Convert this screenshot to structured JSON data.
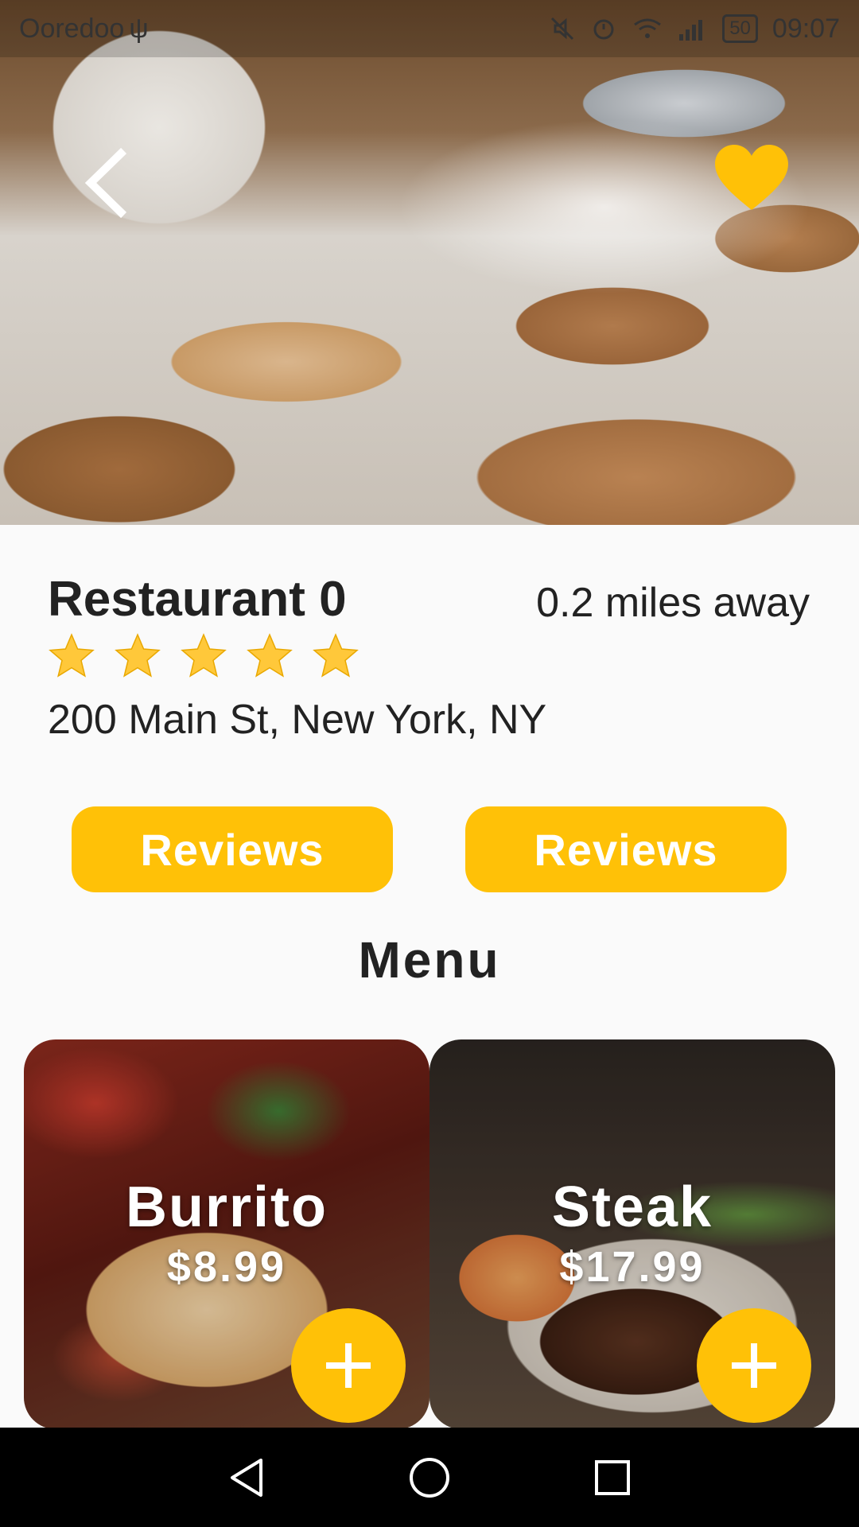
{
  "status_bar": {
    "carrier": "Ooredoo",
    "usb_symbol": "ψ",
    "battery": "50",
    "time": "09:07"
  },
  "icons": {
    "back": "chevron-left-icon",
    "favorite": "heart-icon",
    "rating": "star-icon",
    "add": "plus-icon",
    "nav_back": "triangle-back-icon",
    "nav_home": "circle-home-icon",
    "nav_recents": "square-recents-icon"
  },
  "colors": {
    "accent": "#ffc107",
    "text": "#222222",
    "background": "#fafafa",
    "navbar": "#000000"
  },
  "restaurant": {
    "name": "Restaurant 0",
    "distance": "0.2 miles away",
    "rating": 5,
    "rating_max": 5,
    "address": "200 Main St, New York, NY"
  },
  "actions": {
    "left_label": "Reviews",
    "right_label": "Reviews"
  },
  "menu": {
    "title": "Menu",
    "items": [
      {
        "name": "Burrito",
        "price": "$8.99"
      },
      {
        "name": "Steak",
        "price": "$17.99"
      }
    ]
  }
}
